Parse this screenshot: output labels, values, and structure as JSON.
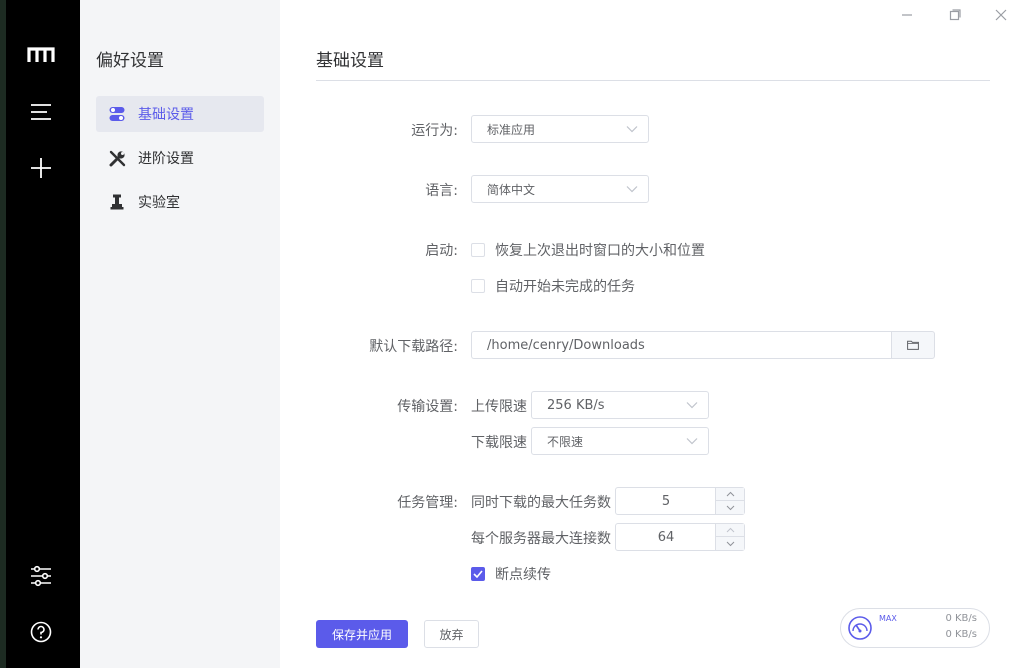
{
  "sidebar": {
    "title": "偏好设置",
    "items": [
      {
        "label": "基础设置"
      },
      {
        "label": "进阶设置"
      },
      {
        "label": "实验室"
      }
    ]
  },
  "main": {
    "title": "基础设置",
    "run_as": {
      "label": "运行为:",
      "value": "标准应用"
    },
    "language": {
      "label": "语言:",
      "value": "简体中文"
    },
    "startup": {
      "label": "启动:",
      "options": [
        {
          "label": "恢复上次退出时窗口的大小和位置",
          "checked": false
        },
        {
          "label": "自动开始未完成的任务",
          "checked": false
        }
      ]
    },
    "download_path": {
      "label": "默认下载路径:",
      "value": "/home/cenry/Downloads"
    },
    "transfer": {
      "label": "传输设置:",
      "upload_label": "上传限速",
      "upload_value": "256 KB/s",
      "download_label": "下载限速",
      "download_value": "不限速"
    },
    "tasks": {
      "label": "任务管理:",
      "max_tasks_label": "同时下载的最大任务数",
      "max_tasks_value": "5",
      "max_conn_label": "每个服务器最大连接数",
      "max_conn_value": "64",
      "resume_label": "断点续传",
      "resume_checked": true
    },
    "save_button": "保存并应用",
    "discard_button": "放弃"
  },
  "speedometer": {
    "max_label": "MAX",
    "upload_speed": "0 KB/s",
    "download_speed": "0 KB/s"
  },
  "colors": {
    "accent": "#5b5bea",
    "sidebar_bg": "#f4f5f7",
    "nav_bg": "#000000"
  },
  "icons": [
    "logo-icon",
    "menu-icon",
    "add-icon",
    "settings-sliders-icon",
    "help-icon",
    "toggle-icon",
    "tools-icon",
    "lab-icon",
    "folder-icon",
    "minimize-icon",
    "maximize-icon",
    "close-icon",
    "gauge-icon"
  ]
}
